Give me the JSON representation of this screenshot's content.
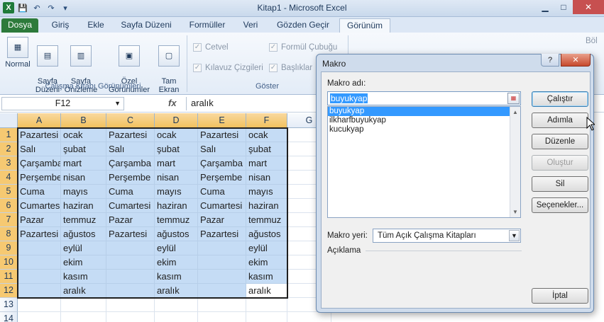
{
  "window": {
    "title": "Kitap1  -  Microsoft Excel"
  },
  "qat": {
    "logo": "X",
    "save": "💾",
    "undo": "↶",
    "redo": "↷",
    "customize": "▾"
  },
  "tabs": [
    "Dosya",
    "Giriş",
    "Ekle",
    "Sayfa Düzeni",
    "Formüller",
    "Veri",
    "Gözden Geçir",
    "Görünüm"
  ],
  "ribbon": {
    "views": [
      {
        "label": "Normal"
      },
      {
        "label": "Sayfa\nDüzeni"
      },
      {
        "label": "Sayfa\nÖnizleme"
      },
      {
        "label": "Özel\nGörünümler"
      },
      {
        "label": "Tam\nEkran"
      }
    ],
    "group_views": "Çalışma Kitabı Görünümleri",
    "show": [
      {
        "label": "Cetvel"
      },
      {
        "label": "Kılavuz Çizgileri"
      },
      {
        "label": "Formül Çubuğu"
      },
      {
        "label": "Başlıklar"
      }
    ],
    "group_show": "Göster",
    "extra": "Böl"
  },
  "formula_bar": {
    "name_box": "F12",
    "fx": "fx",
    "value": "aralık"
  },
  "columns": [
    "A",
    "B",
    "C",
    "D",
    "E",
    "F",
    "G"
  ],
  "rows": [
    "1",
    "2",
    "3",
    "4",
    "5",
    "6",
    "7",
    "8",
    "9",
    "10",
    "11",
    "12",
    "13",
    "14"
  ],
  "cells": [
    [
      "Pazartesi",
      "ocak",
      "Pazartesi",
      "ocak",
      "Pazartesi",
      "ocak"
    ],
    [
      "Salı",
      "şubat",
      "Salı",
      "şubat",
      "Salı",
      "şubat"
    ],
    [
      "Çarşamba",
      "mart",
      "Çarşamba",
      "mart",
      "Çarşamba",
      "mart"
    ],
    [
      "Perşembe",
      "nisan",
      "Perşembe",
      "nisan",
      "Perşembe",
      "nisan"
    ],
    [
      "Cuma",
      "mayıs",
      "Cuma",
      "mayıs",
      "Cuma",
      "mayıs"
    ],
    [
      "Cumartesi",
      "haziran",
      "Cumartesi",
      "haziran",
      "Cumartesi",
      "haziran"
    ],
    [
      "Pazar",
      "temmuz",
      "Pazar",
      "temmuz",
      "Pazar",
      "temmuz"
    ],
    [
      "Pazartesi",
      "ağustos",
      "Pazartesi",
      "ağustos",
      "Pazartesi",
      "ağustos"
    ],
    [
      "",
      "eylül",
      "",
      "eylül",
      "",
      "eylül"
    ],
    [
      "",
      "ekim",
      "",
      "ekim",
      "",
      "ekim"
    ],
    [
      "",
      "kasım",
      "",
      "kasım",
      "",
      "kasım"
    ],
    [
      "",
      "aralık",
      "",
      "aralık",
      "",
      "aralık"
    ]
  ],
  "dialog": {
    "title": "Makro",
    "help": "?",
    "close": "✕",
    "name_label": "Makro adı:",
    "name_value": "buyukyap",
    "macros": [
      "buyukyap",
      "ilkharfbuyukyap",
      "kucukyap"
    ],
    "location_label": "Makro yeri:",
    "location_value": "Tüm Açık Çalışma Kitapları",
    "description_label": "Açıklama",
    "buttons": {
      "run": "Çalıştır",
      "step": "Adımla",
      "edit": "Düzenle",
      "create": "Oluştur",
      "delete": "Sil",
      "options": "Seçenekler...",
      "cancel": "İptal"
    }
  }
}
